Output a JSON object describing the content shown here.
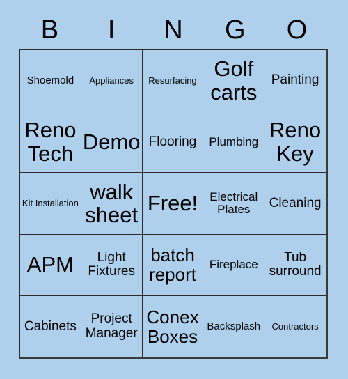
{
  "card": {
    "background_color": "#aed0ec",
    "border_color": "#2b2b2b",
    "text_color": "#000000",
    "header_letters": [
      "B",
      "I",
      "N",
      "G",
      "O"
    ],
    "columns": 5,
    "rows": 5,
    "cells": [
      {
        "text": "Shoemold",
        "size": "sm"
      },
      {
        "text": "Appliances",
        "size": "xs"
      },
      {
        "text": "Resurfacing",
        "size": "xs"
      },
      {
        "text": "Golf carts",
        "size": "xxl"
      },
      {
        "text": "Painting",
        "size": "lg"
      },
      {
        "text": "Reno Tech",
        "size": "xxl"
      },
      {
        "text": "Demo",
        "size": "xxl"
      },
      {
        "text": "Flooring",
        "size": "lg"
      },
      {
        "text": "Plumbing",
        "size": "md"
      },
      {
        "text": "Reno Key",
        "size": "xxl"
      },
      {
        "text": "Kit Installation",
        "size": "xs"
      },
      {
        "text": "walk sheet",
        "size": "xxl"
      },
      {
        "text": "Free!",
        "size": "xxl"
      },
      {
        "text": "Electrical Plates",
        "size": "md"
      },
      {
        "text": "Cleaning",
        "size": "lg"
      },
      {
        "text": "APM",
        "size": "xxl"
      },
      {
        "text": "Light Fixtures",
        "size": "lg"
      },
      {
        "text": "batch report",
        "size": "xl"
      },
      {
        "text": "Fireplace",
        "size": "md"
      },
      {
        "text": "Tub surround",
        "size": "lg"
      },
      {
        "text": "Cabinets",
        "size": "lg"
      },
      {
        "text": "Project Manager",
        "size": "lg"
      },
      {
        "text": "Conex Boxes",
        "size": "xl"
      },
      {
        "text": "Backsplash",
        "size": "sm"
      },
      {
        "text": "Contractors",
        "size": "xs"
      }
    ]
  }
}
